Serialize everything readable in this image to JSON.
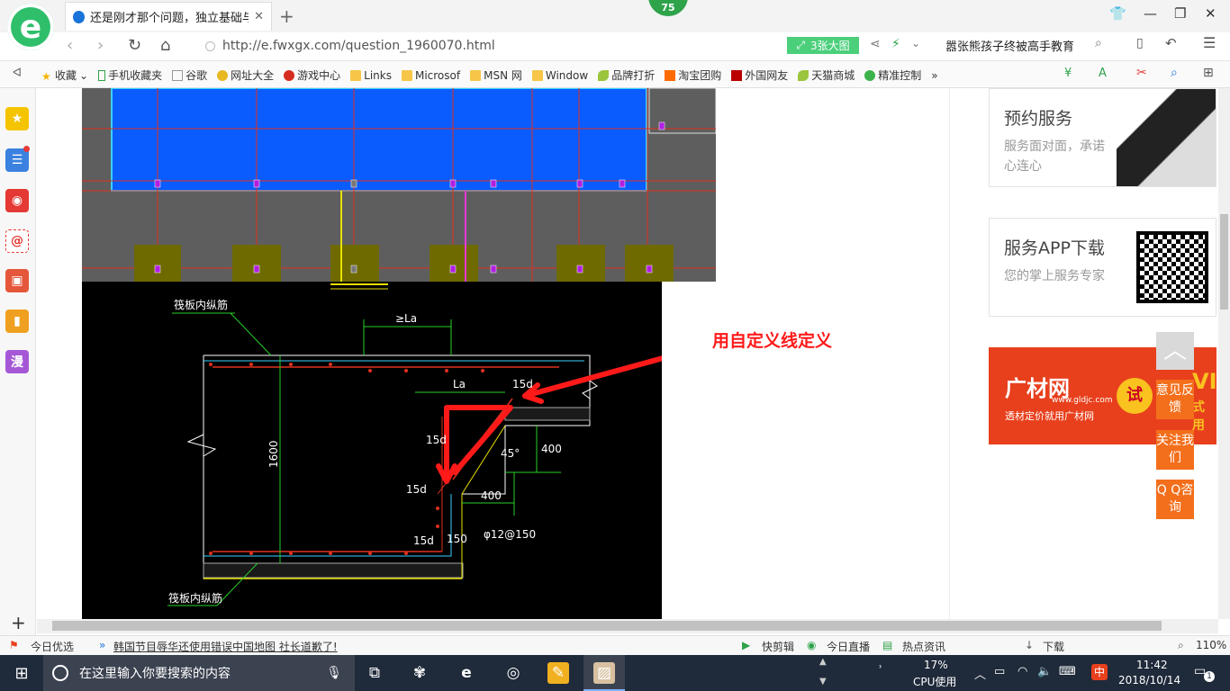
{
  "browser": {
    "tab_title": "还是刚才那个问题，独立基础与筏",
    "new_tab": "+",
    "badge_count": "75",
    "url": "http://e.fwxgx.com/question_1960070.html",
    "big_image_label": "3张大图",
    "search_text": "嚣张熊孩子终被高手教育",
    "colors": {
      "accent": "#2ea34a",
      "brand_green": "#4ccf7b"
    }
  },
  "bookmarks": [
    {
      "label": "收藏",
      "icon": "star-icon"
    },
    {
      "label": "手机收藏夹",
      "icon": "phone-icon"
    },
    {
      "label": "谷歌",
      "icon": "page-icon"
    },
    {
      "label": "网址大全",
      "icon": "globe-icon"
    },
    {
      "label": "游戏中心",
      "icon": "game-icon"
    },
    {
      "label": "Links",
      "icon": "folder-icon"
    },
    {
      "label": "Microsof",
      "icon": "folder-icon"
    },
    {
      "label": "MSN 网",
      "icon": "folder-icon"
    },
    {
      "label": "Window",
      "icon": "folder-icon"
    },
    {
      "label": "品牌打折",
      "icon": "leaf-icon"
    },
    {
      "label": "淘宝团购",
      "icon": "tao-icon"
    },
    {
      "label": "外国网友",
      "icon": "flag-icon"
    },
    {
      "label": "天猫商城",
      "icon": "leaf-icon"
    },
    {
      "label": "精准控制",
      "icon": "chat-icon"
    }
  ],
  "bookmarks_more": "»",
  "sidebar": {
    "items": [
      {
        "icon": "star-icon"
      },
      {
        "icon": "news-icon"
      },
      {
        "icon": "weibo-icon"
      },
      {
        "icon": "mail-icon"
      },
      {
        "icon": "game-icon"
      },
      {
        "icon": "book-icon"
      },
      {
        "icon": "comic-icon",
        "label": "漫"
      }
    ],
    "add": "+"
  },
  "drawing": {
    "annotation": "用自定义线定义",
    "labels": {
      "top_rebar": "筏板内纵筋",
      "bottom_rebar": "筏板内纵筋",
      "la_top": "≥La",
      "la": "La",
      "d15_top": "15d",
      "d15_left": "15d",
      "d15_mid": "15d",
      "d15_bottom": "15d",
      "dim_1600": "1600",
      "dim_400_v": "400",
      "dim_400_h": "400",
      "dim_45": "45°",
      "dim_150": "150",
      "rebar_spec": "φ12@150"
    }
  },
  "right_panel": {
    "service_title": "预约服务",
    "service_desc": "服务面对面，承诺心连心",
    "app_title": "服务APP下载",
    "app_desc": "您的掌上服务专家",
    "banner_brand": "广材网",
    "banner_url": "www.gldjc.com",
    "banner_slogan": "透材定价就用广材网",
    "banner_try": "试",
    "banner_vip": "VIP",
    "banner_vip_sub": "式用"
  },
  "float_buttons": {
    "top": "︿",
    "feedback": "意见反馈",
    "follow": "关注我们",
    "qq": "Q Q咨询"
  },
  "status_bar": {
    "today_pick": "今日优选",
    "news": "韩国节目辱华还使用错误中国地图 社长道歉了!",
    "quick_cut": "快剪辑",
    "live": "今日直播",
    "hot_news": "热点资讯",
    "download": "下载",
    "zoom": "110%"
  },
  "taskbar": {
    "search_placeholder": "在这里输入你要搜索的内容",
    "cpu_percent": "17%",
    "cpu_label": "CPU使用",
    "time": "11:42",
    "date": "2018/10/14",
    "ime": "中",
    "notifications": "1"
  }
}
